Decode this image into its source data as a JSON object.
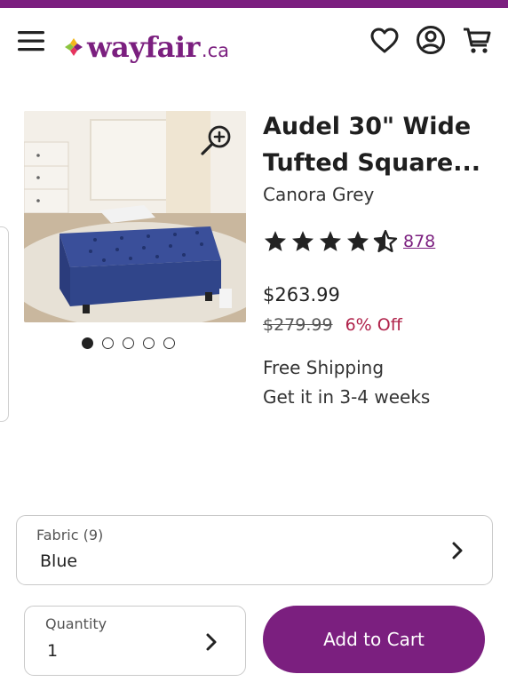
{
  "brand_color": "#7b1f7f",
  "header": {
    "logo_word": "wayfair",
    "logo_tld": ".ca",
    "icons": [
      "menu-icon",
      "heart-icon",
      "account-icon",
      "cart-icon"
    ]
  },
  "gallery": {
    "image_count": 5,
    "active_index": 0
  },
  "product": {
    "title": "Audel 30\" Wide Tufted Square...",
    "brand": "Canora Grey",
    "rating": 4.5,
    "review_count": "878",
    "price": "$263.99",
    "old_price": "$279.99",
    "discount": "6% Off",
    "shipping": "Free Shipping",
    "delivery": "Get it in 3-4 weeks"
  },
  "options": {
    "fabric_label": "Fabric (9)",
    "fabric_value": "Blue"
  },
  "purchase": {
    "quantity_label": "Quantity",
    "quantity_value": "1",
    "add_to_cart_label": "Add to Cart"
  }
}
